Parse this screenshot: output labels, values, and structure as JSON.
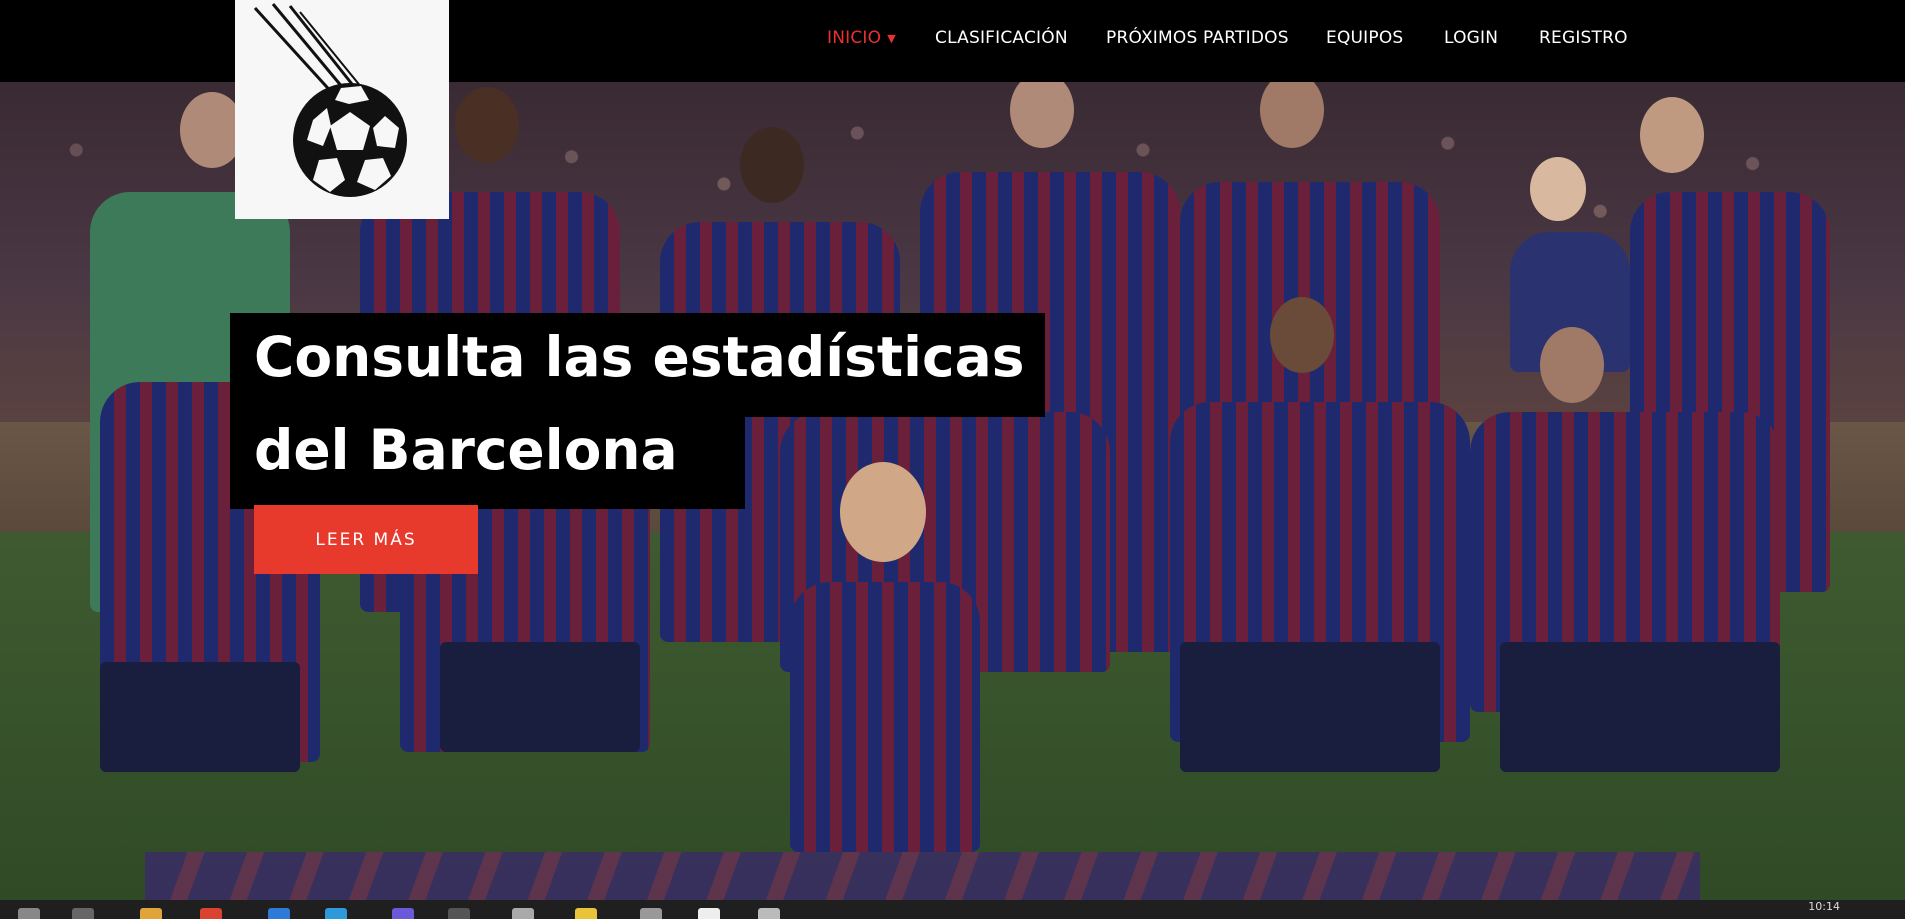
{
  "nav": {
    "items": [
      {
        "label": "INICIO",
        "active": true
      },
      {
        "label": "CLASIFICACIÓN"
      },
      {
        "label": "PRÓXIMOS PARTIDOS"
      },
      {
        "label": "EQUIPOS"
      },
      {
        "label": "LOGIN"
      },
      {
        "label": "REGISTRO"
      }
    ],
    "active_color": "#e8322f"
  },
  "logo": {
    "icon": "soccer-ball-icon"
  },
  "hero": {
    "headline_line1": "Consulta las estadísticas",
    "headline_line2": "del Barcelona",
    "cta_label": "LEER MÁS",
    "cta_color": "#e8392d"
  },
  "taskbar": {
    "clock": "10:14",
    "icons": [
      "start-icon",
      "search-icon",
      "file-explorer-icon",
      "chrome-icon",
      "store-icon",
      "edge-icon",
      "teams-icon",
      "terminal-icon",
      "notepad-icon",
      "folder-icon",
      "settings-icon",
      "github-icon",
      "vscode-icon"
    ]
  }
}
